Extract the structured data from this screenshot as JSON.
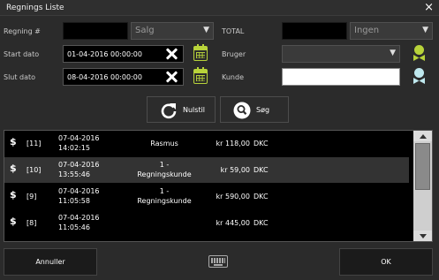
{
  "window": {
    "title": "Regnings Liste",
    "close_label": "×"
  },
  "filters": {
    "regning_label": "Regning #",
    "regning_value": "",
    "type_selected": "Salg",
    "total_label": "TOTAL",
    "total_value": "",
    "total_filter_selected": "Ingen",
    "start_label": "Start dato",
    "start_value": "01-04-2016 00:00:00",
    "end_label": "Slut dato",
    "end_value": "08-04-2016 00:00:00",
    "bruger_label": "Bruger",
    "bruger_selected": "",
    "kunde_label": "Kunde",
    "kunde_value": ""
  },
  "actions": {
    "reset_label": "Nulstil",
    "search_label": "Søg"
  },
  "list": {
    "rows": [
      {
        "icon": "$",
        "number": "[11]",
        "date": "07-04-2016",
        "time": "14:02:15",
        "customer": "Rasmus",
        "amount": "kr 118,00",
        "currency": "DKC"
      },
      {
        "icon": "$",
        "number": "[10]",
        "date": "07-04-2016",
        "time": "13:55:46",
        "customer": "1 -\nRegningskunde",
        "amount": "kr 59,00",
        "currency": "DKC"
      },
      {
        "icon": "$",
        "number": "[9]",
        "date": "07-04-2016",
        "time": "11:05:58",
        "customer": "1 -\nRegningskunde",
        "amount": "kr 590,00",
        "currency": "DKC"
      },
      {
        "icon": "$",
        "number": "[8]",
        "date": "07-04-2016",
        "time": "11:05:46",
        "customer": "",
        "amount": "kr 445,00",
        "currency": "DKC"
      }
    ]
  },
  "footer": {
    "cancel_label": "Annuller",
    "ok_label": "OK"
  },
  "colors": {
    "accent_green": "#b8d33a",
    "accent_cyan": "#bfe8ee",
    "row_alt": "#333333"
  }
}
